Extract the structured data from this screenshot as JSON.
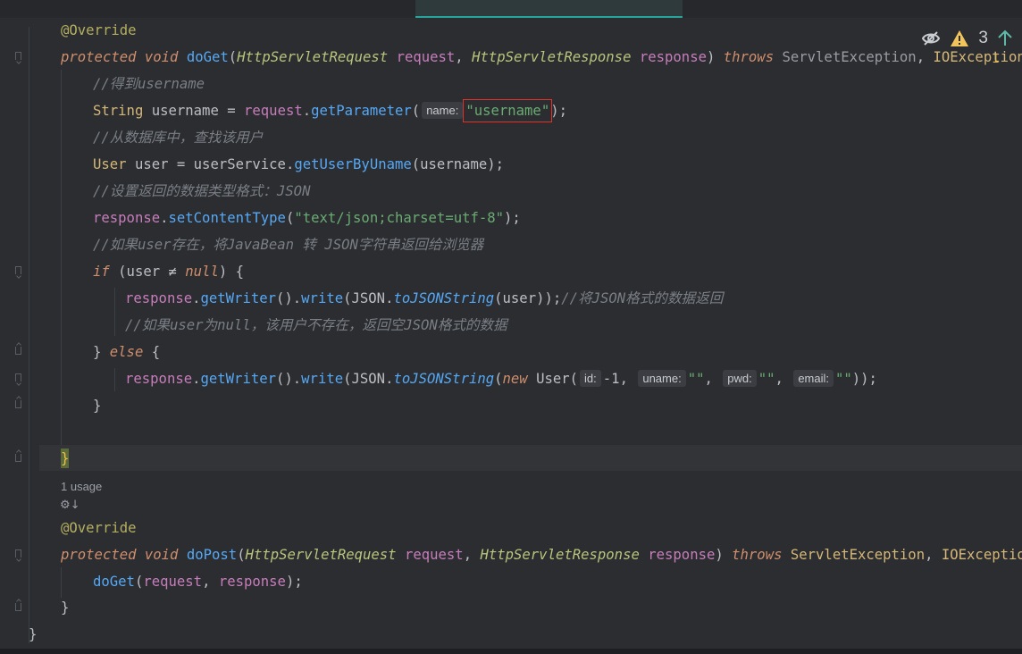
{
  "status": {
    "eye_icon": "eye-slash-icon",
    "warning_icon": "warning-icon",
    "warning_count": "3",
    "arrow_icon": "arrow-up-icon",
    "scroll_marker": "1"
  },
  "code": {
    "l1_annotation": "@Override",
    "l2_kw1": "protected",
    "l2_kw2": "void",
    "l2_fn": "doGet",
    "l2_open": "(",
    "l2_type1": "HttpServletRequest",
    "l2_p1": "request",
    "l2_comma": ", ",
    "l2_type2": "HttpServletResponse",
    "l2_p2": "response",
    "l2_close": ") ",
    "l2_throws": "throws",
    "l2_ex1": "ServletException",
    "l2_comma2": ", ",
    "l2_ex2": "IOException",
    "l3_comment": "//得到username",
    "l4_type": "String",
    "l4_rest": " username = ",
    "l4_obj": "request",
    "l4_dot": ".",
    "l4_fn": "getParameter",
    "l4_paren": "(",
    "l4_hint": "name:",
    "l4_str": "\"username\"",
    "l4_end": ");",
    "l5_comment": "//从数据库中，查找该用户",
    "l6_type": "User",
    "l6_rest": " user = userService.",
    "l6_fn": "getUserByUname",
    "l6_end": "(username);",
    "l7_comment": "//设置返回的数据类型格式：JSON",
    "l8_obj": "response",
    "l8_dot": ".",
    "l8_fn": "setContentType",
    "l8_open": "(",
    "l8_str": "\"text/json;charset=utf-8\"",
    "l8_end": ");",
    "l9_comment": "//如果user存在，将JavaBean 转 JSON字符串返回给浏览器",
    "l10_kw": "if",
    "l10_mid": " (user ≠ ",
    "l10_null": "null",
    "l10_end": ") {",
    "l11_obj": "response",
    "l11_dot": ".",
    "l11_fn1": "getWriter",
    "l11_mid": "().",
    "l11_fn2": "write",
    "l11_open": "(JSON.",
    "l11_static": "toJSONString",
    "l11_end": "(user));",
    "l11_comment": "//将JSON格式的数据返回",
    "l12_comment": "//如果user为null，该用户不存在，返回空JSON格式的数据",
    "l13_open": "} ",
    "l13_kw": "else",
    "l13_end": " {",
    "l14_obj": "response",
    "l14_dot": ".",
    "l14_fn1": "getWriter",
    "l14_mid": "().",
    "l14_fn2": "write",
    "l14_open": "(JSON.",
    "l14_static": "toJSONString",
    "l14_p": "(",
    "l14_new": "new",
    "l14_cls": " User(",
    "l14_hint1": "id:",
    "l14_v1": "-1",
    "l14_c1": ", ",
    "l14_hint2": "uname:",
    "l14_v2": "\"\"",
    "l14_c2": ", ",
    "l14_hint3": "pwd:",
    "l14_v3": "\"\"",
    "l14_c3": ", ",
    "l14_hint4": "email:",
    "l14_v4": "\"\"",
    "l14_end": "));",
    "l15_brace": "}",
    "l17_brace": "}",
    "usage_label": "1 usage",
    "usage_icons": "⚙↓",
    "l18_annotation": "@Override",
    "l19_kw1": "protected",
    "l19_kw2": "void",
    "l19_fn": "doPost",
    "l19_open": "(",
    "l19_type1": "HttpServletRequest",
    "l19_p1": "request",
    "l19_comma": ", ",
    "l19_type2": "HttpServletResponse",
    "l19_p2": "response",
    "l19_close": ") ",
    "l19_throws": "throws",
    "l19_ex1": "ServletException",
    "l19_comma2": ", ",
    "l19_ex2": "IOException",
    "l19_brace": " {",
    "l20_fn": "doGet",
    "l20_open": "(",
    "l20_p1": "request",
    "l20_comma": ", ",
    "l20_p2": "response",
    "l20_end": ");",
    "l21_brace": "}",
    "l22_brace": "}"
  }
}
